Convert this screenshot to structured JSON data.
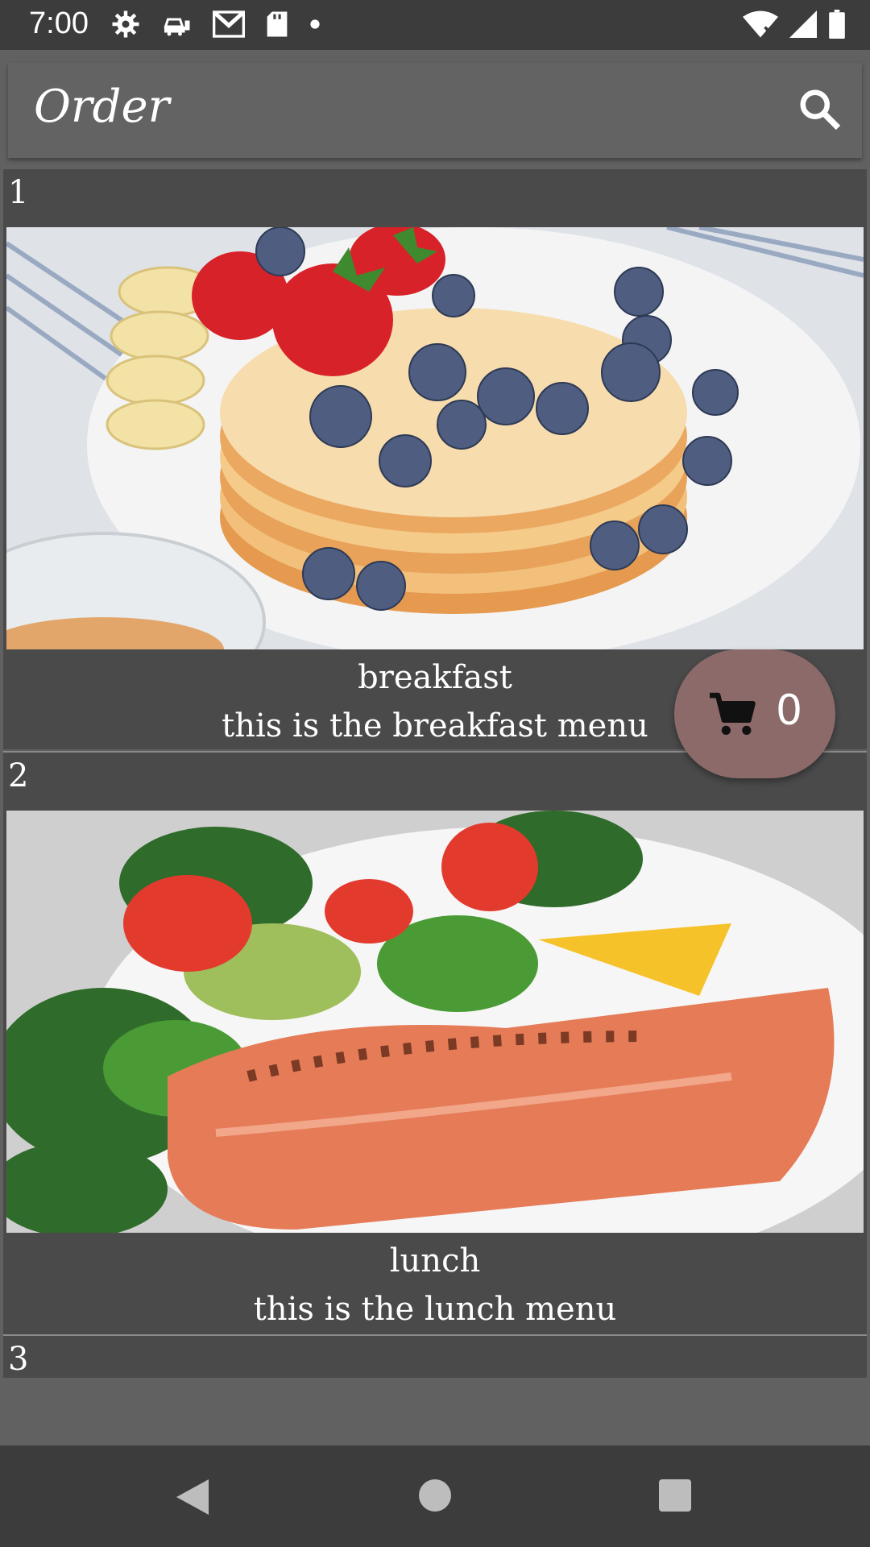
{
  "status_bar": {
    "time": "7:00",
    "icons": [
      "settings-icon",
      "car-icon",
      "gmail-icon",
      "sd-card-icon",
      "dot-icon"
    ],
    "right_icons": [
      "wifi-icon",
      "signal-icon",
      "battery-icon"
    ]
  },
  "app_bar": {
    "title": "Order",
    "search_icon": "search-icon"
  },
  "menu_items": [
    {
      "number": "1",
      "title": "breakfast",
      "description": "this is the breakfast menu"
    },
    {
      "number": "2",
      "title": "lunch",
      "description": "this is the lunch menu"
    },
    {
      "number": "3"
    }
  ],
  "cart_button": {
    "count": "0",
    "icon": "cart-icon",
    "color": "#8d6a6a"
  },
  "nav_bar": {
    "icons": [
      "back-icon",
      "home-icon",
      "recents-icon"
    ]
  },
  "colors": {
    "status_bar": "#3c3c3c",
    "app_bar": "#636363",
    "card": "#4a4a4a",
    "background": "#616161"
  }
}
